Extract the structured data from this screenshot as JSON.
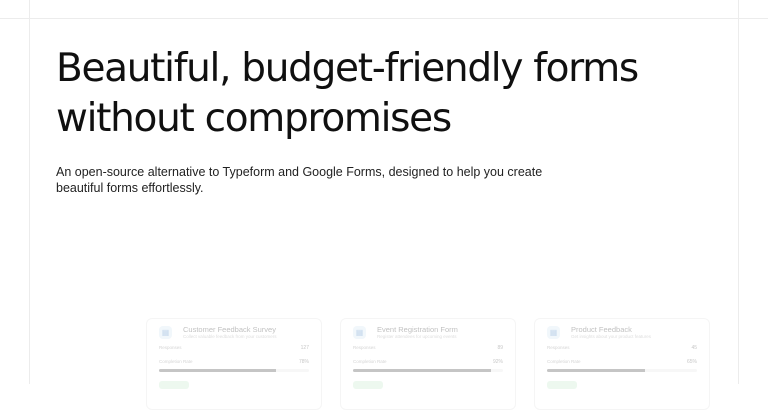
{
  "hero": {
    "headline_line1": "Beautiful, budget-friendly forms",
    "headline_line2": "without compromises",
    "subtitle_line1": "An open-source alternative to Typeform and Google Forms, designed to help you create",
    "subtitle_line2": "beautiful forms effortlessly."
  },
  "preview": {
    "cards": [
      {
        "title": "Customer Feedback Survey",
        "description": "Collect valuable feedback from your customers",
        "responses_label": "Responses",
        "responses": "127",
        "completion_label": "Completion Rate",
        "completion": "78%",
        "completion_fraction": 0.78
      },
      {
        "title": "Event Registration Form",
        "description": "Register attendees for upcoming events",
        "responses_label": "Responses",
        "responses": "89",
        "completion_label": "Completion Rate",
        "completion": "92%",
        "completion_fraction": 0.92
      },
      {
        "title": "Product Feedback",
        "description": "Get insights about your product features",
        "responses_label": "Responses",
        "responses": "45",
        "completion_label": "Completion Rate",
        "completion": "65%",
        "completion_fraction": 0.65
      }
    ]
  }
}
